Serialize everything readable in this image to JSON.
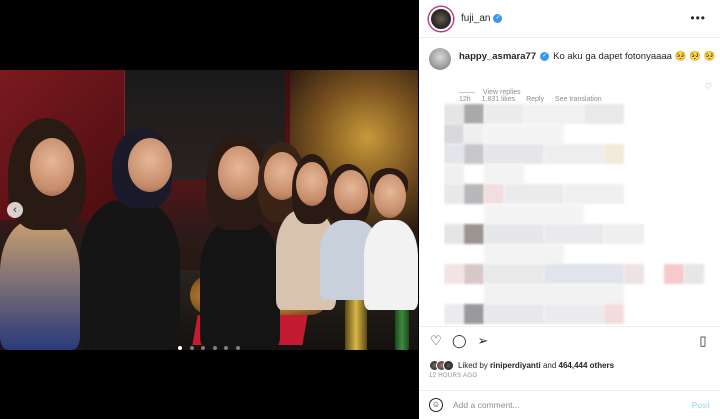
{
  "post": {
    "username": "fuji_an",
    "more_icon": "more-horizontal-icon"
  },
  "comment": {
    "username": "happy_asmara77",
    "text": "Ko aku ga dapet fotonyaaaa 🥺 🥺 🥺",
    "age": "12h",
    "likes": "1,831 likes",
    "reply": "Reply",
    "see_translation": "See translation",
    "view_replies": "View replies"
  },
  "likes": {
    "prefix": "Liked by ",
    "user": "riniperdiyanti",
    "middle": " and ",
    "count": "464,444 others"
  },
  "timestamp": "12 HOURS AGO",
  "add_comment": {
    "placeholder": "Add a comment...",
    "post_label": "Post"
  },
  "carousel": {
    "prev_arrow": "‹",
    "slide_count": 6,
    "active_slide": 1
  },
  "colors": {
    "verified": "#3897f0",
    "post_disabled": "#b2dffc",
    "muted": "#8e8e8e"
  }
}
